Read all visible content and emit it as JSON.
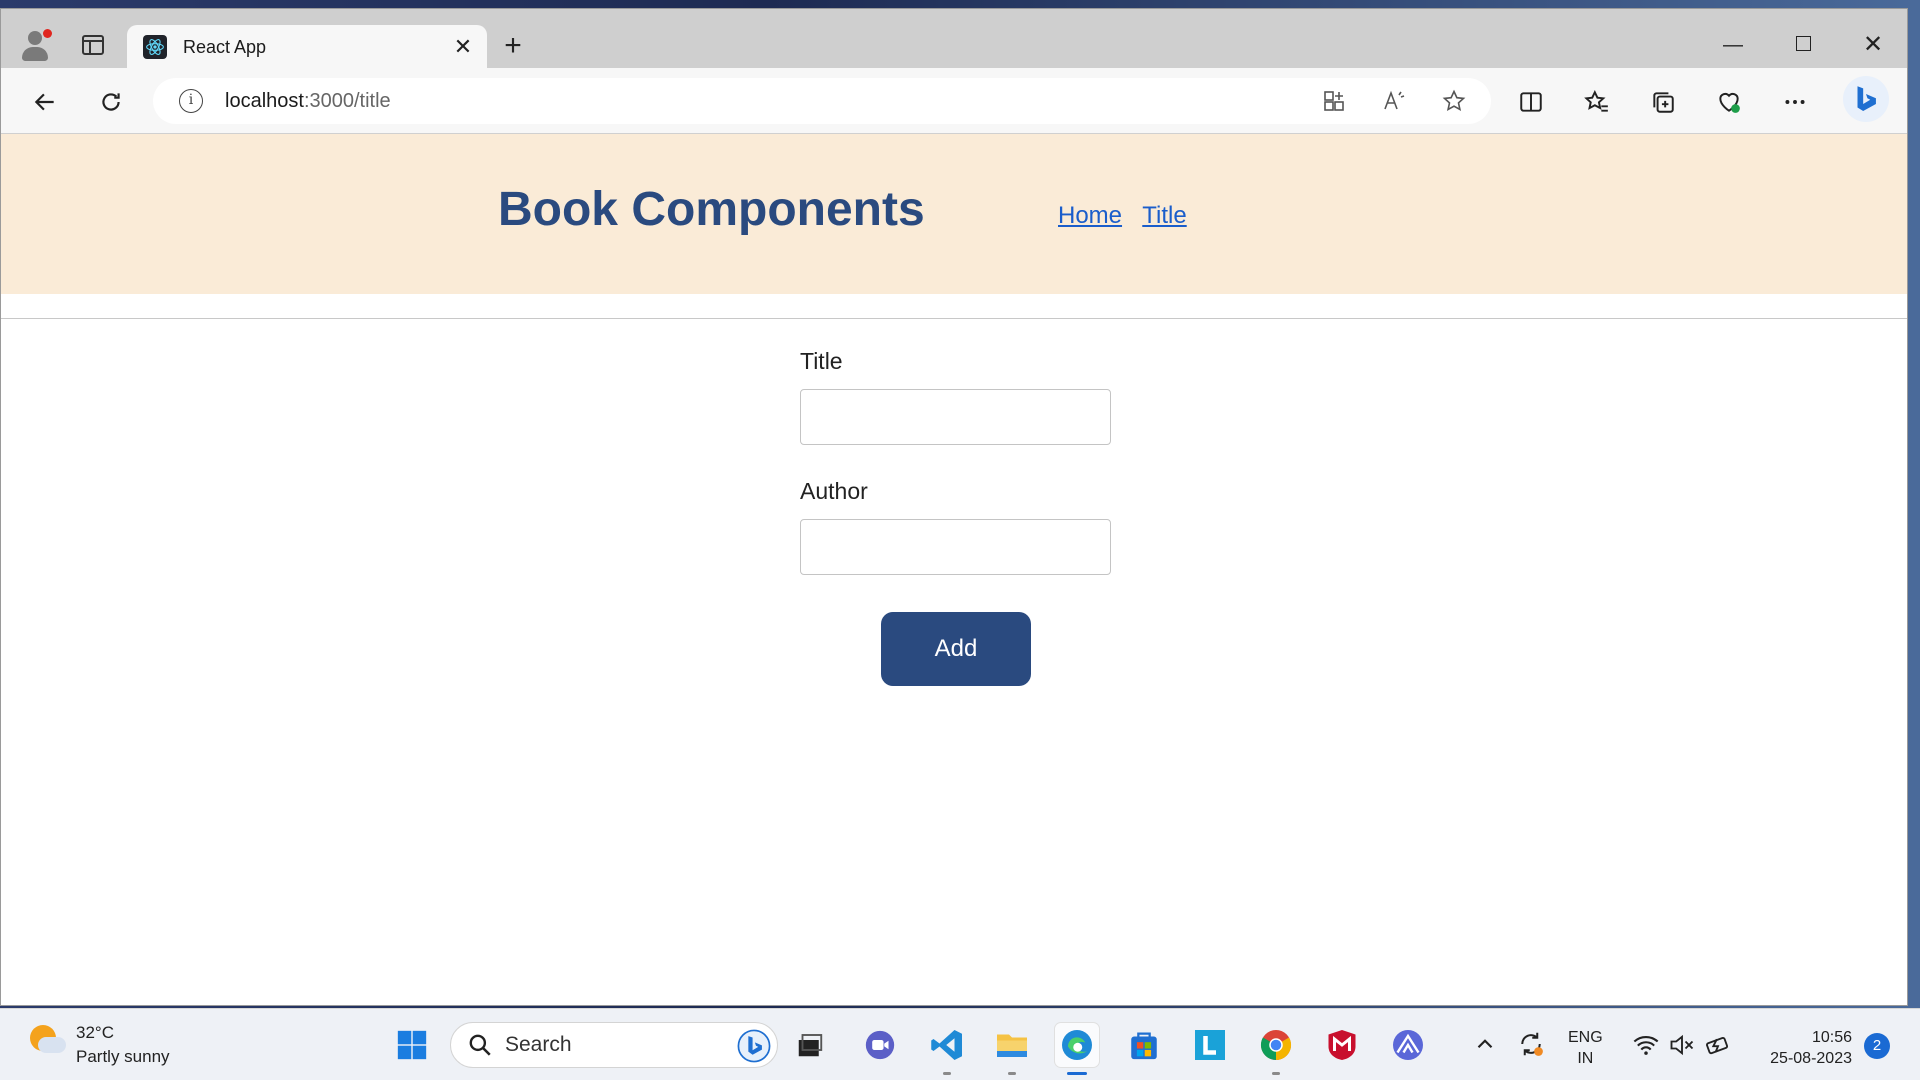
{
  "browser": {
    "tab_title": "React App",
    "url_host": "localhost",
    "url_rest": ":3000/title",
    "new_tab_symbol": "+",
    "close_tab_symbol": "✕"
  },
  "app": {
    "brand": "Book Components",
    "nav": [
      {
        "label": "Home"
      },
      {
        "label": "Title"
      }
    ],
    "form": {
      "title_label": "Title",
      "title_value": "",
      "author_label": "Author",
      "author_value": "",
      "submit_label": "Add"
    }
  },
  "taskbar": {
    "weather_temp": "32°C",
    "weather_desc": "Partly sunny",
    "search_placeholder": "Search",
    "language_line1": "ENG",
    "language_line2": "IN",
    "time": "10:56",
    "date": "25-08-2023",
    "notification_count": "2"
  },
  "colors": {
    "header_bg": "#faebd7",
    "brand_color": "#2a4a7f",
    "link_color": "#1a5dcb",
    "button_bg": "#2a4a7f"
  },
  "icons": [
    "profile-icon",
    "tab-actions-icon",
    "react-favicon",
    "back-icon",
    "refresh-icon",
    "info-icon",
    "apps-icon",
    "read-aloud-icon",
    "favorite-star-icon",
    "split-screen-icon",
    "favorites-icon",
    "collections-icon",
    "browser-essentials-icon",
    "more-icon",
    "bing-copilot-icon"
  ]
}
